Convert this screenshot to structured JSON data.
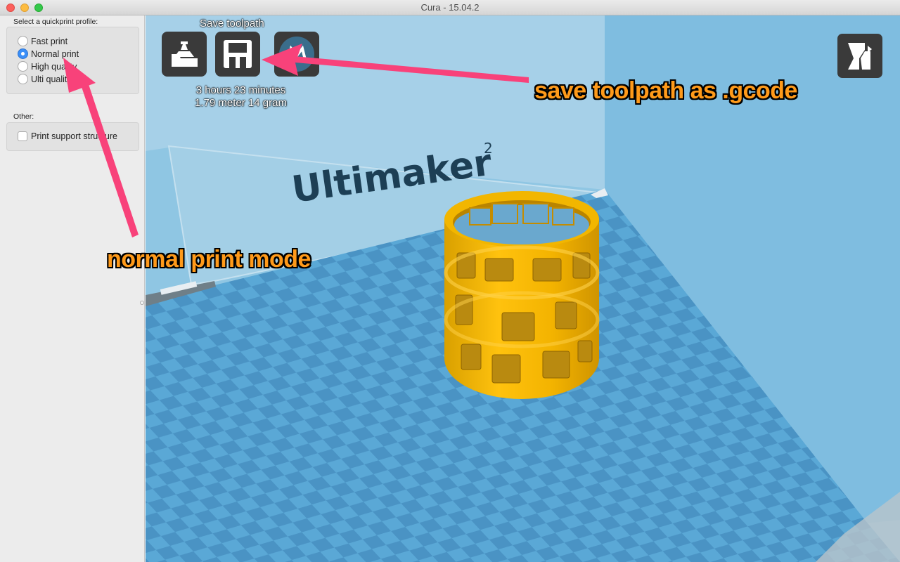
{
  "window": {
    "title": "Cura - 15.04.2",
    "controls": [
      "close",
      "minimize",
      "maximize"
    ]
  },
  "sidebar": {
    "profile_label": "Select a quickprint profile:",
    "profiles": [
      {
        "label": "Fast print",
        "selected": false
      },
      {
        "label": "Normal print",
        "selected": true
      },
      {
        "label": "High quality",
        "selected": false
      },
      {
        "label": "Ulti quality",
        "selected": false
      }
    ],
    "other_label": "Other:",
    "support_label": "Print support structure",
    "support_checked": false
  },
  "toolbar": {
    "save_caption": "Save toolpath",
    "buttons": [
      {
        "name": "load-model",
        "icon": "load-model-icon"
      },
      {
        "name": "save-toolpath",
        "icon": "floppy-disk-icon"
      },
      {
        "name": "youmagine",
        "icon": "youmagine-icon"
      }
    ],
    "print_time": "3 hours 23 minutes",
    "print_material": "1.79 meter 14 gram"
  },
  "viewport": {
    "brand_text": "Ultimaker",
    "brand_superscript": "2",
    "model_color": "#f5b800",
    "bed_colors": [
      "#5aa8d6",
      "#4a93c4"
    ],
    "view_mode_icon": "view-mode-icon"
  },
  "annotations": {
    "save_note": "save toolpath as .gcode",
    "mode_note": "normal print mode",
    "arrow_color": "#f8427a"
  }
}
